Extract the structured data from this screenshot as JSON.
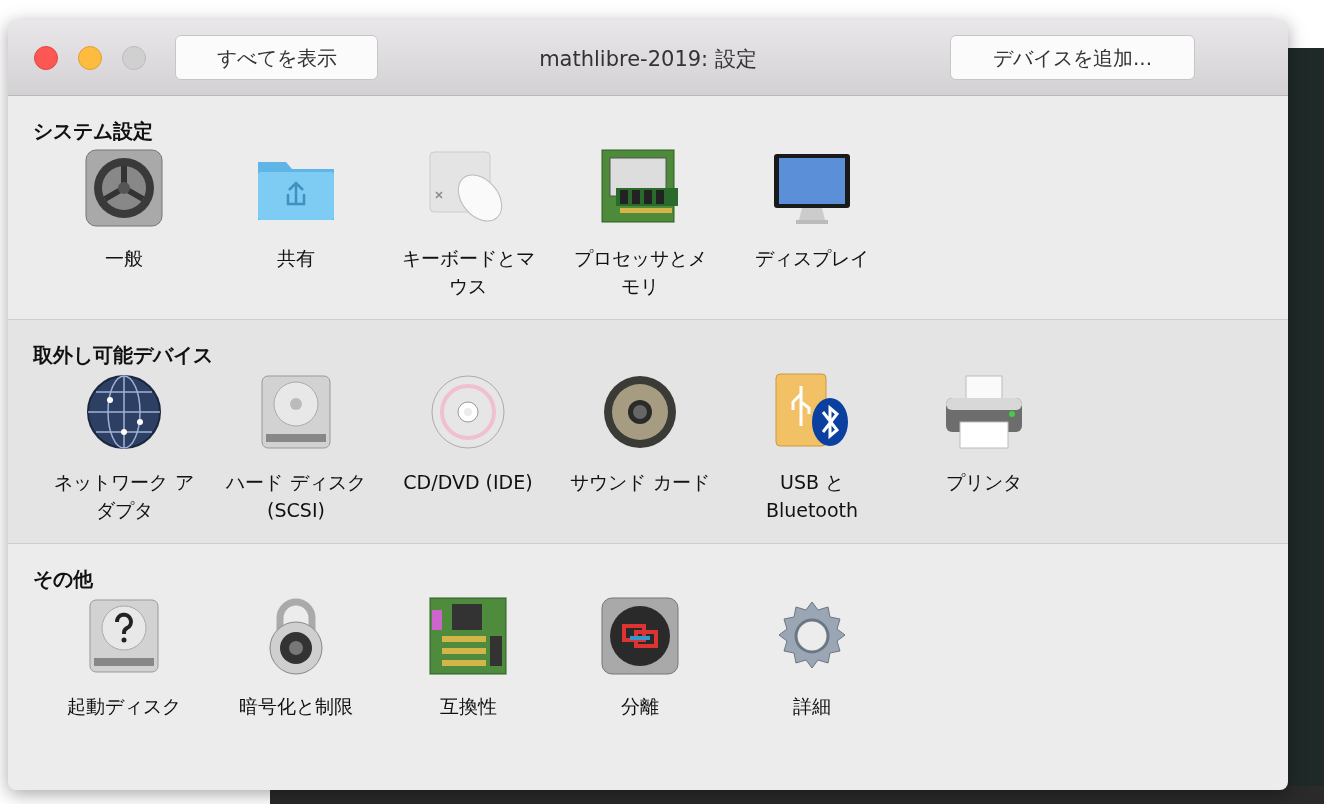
{
  "window": {
    "title": "mathlibre-2019: 設定"
  },
  "toolbar": {
    "show_all_button": "すべてを表示",
    "add_device_button": "デバイスを追加..."
  },
  "sections": [
    {
      "title": "システム設定",
      "items": [
        {
          "label": "一般"
        },
        {
          "label": "共有"
        },
        {
          "label": "キーボードとマウス"
        },
        {
          "label": "プロセッサとメモリ"
        },
        {
          "label": "ディスプレイ"
        }
      ]
    },
    {
      "title": "取外し可能デバイス",
      "items": [
        {
          "label": "ネットワーク アダプタ"
        },
        {
          "label": "ハード ディスク (SCSI)"
        },
        {
          "label": "CD/DVD (IDE)"
        },
        {
          "label": "サウンド カード"
        },
        {
          "label": "USB と Bluetooth"
        },
        {
          "label": "プリンタ"
        }
      ]
    },
    {
      "title": "その他",
      "items": [
        {
          "label": "起動ディスク"
        },
        {
          "label": "暗号化と制限"
        },
        {
          "label": "互換性"
        },
        {
          "label": "分離"
        },
        {
          "label": "詳細"
        }
      ]
    }
  ]
}
